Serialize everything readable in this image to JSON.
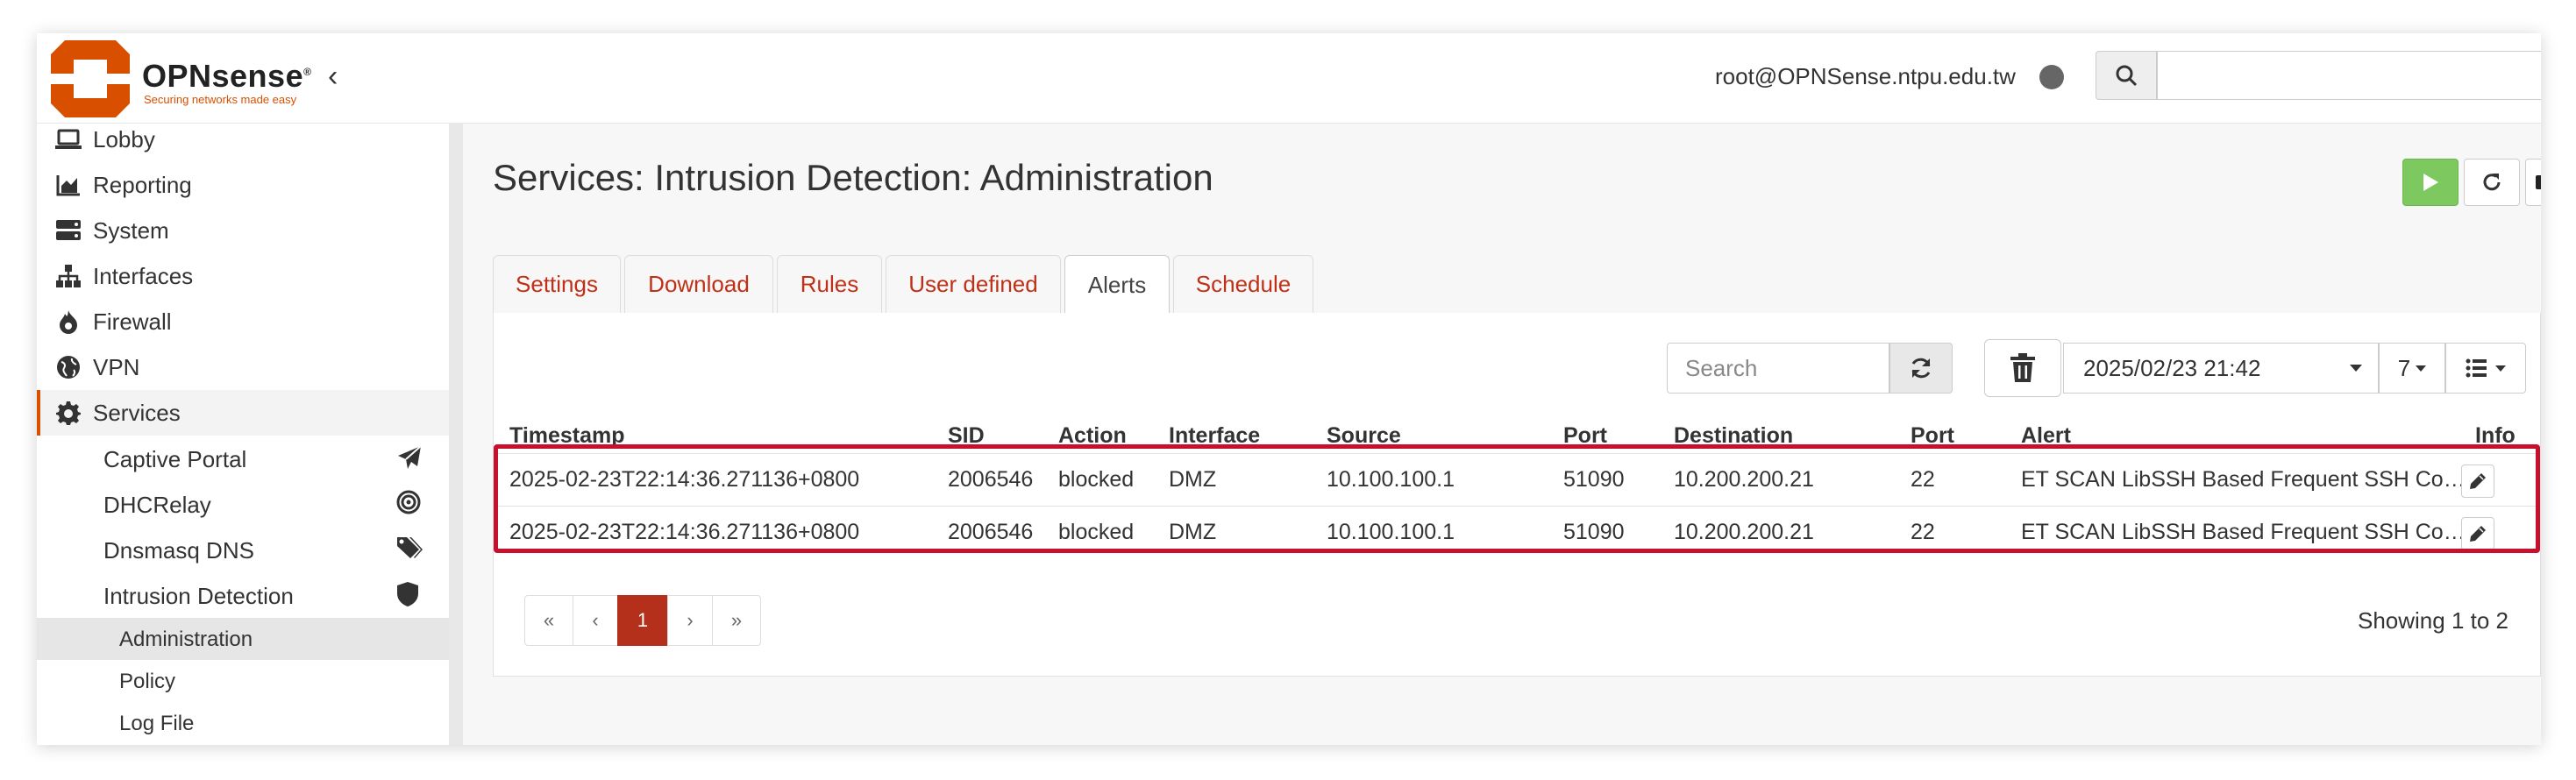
{
  "header": {
    "brand": "OPNsense",
    "brand_mark": "®",
    "tagline": "Securing networks made easy",
    "user": "root@OPNSense.ntpu.edu.tw",
    "colors": {
      "brand": "#d94f00",
      "accent": "#c03017"
    }
  },
  "sidebar": {
    "items": [
      {
        "label": "Lobby",
        "icon": "laptop-icon"
      },
      {
        "label": "Reporting",
        "icon": "area-chart-icon"
      },
      {
        "label": "System",
        "icon": "server-icon"
      },
      {
        "label": "Interfaces",
        "icon": "sitemap-icon"
      },
      {
        "label": "Firewall",
        "icon": "fire-icon"
      },
      {
        "label": "VPN",
        "icon": "globe-icon"
      },
      {
        "label": "Services",
        "icon": "gear-icon"
      }
    ],
    "services": [
      {
        "label": "Captive Portal",
        "icon": "paper-plane-icon"
      },
      {
        "label": "DHCRelay",
        "icon": "bullseye-icon"
      },
      {
        "label": "Dnsmasq DNS",
        "icon": "tags-icon"
      },
      {
        "label": "Intrusion Detection",
        "icon": "shield-icon"
      }
    ],
    "ids": [
      {
        "label": "Administration"
      },
      {
        "label": "Policy"
      },
      {
        "label": "Log File"
      }
    ]
  },
  "page": {
    "title": "Services: Intrusion Detection: Administration"
  },
  "tabs": [
    {
      "label": "Settings"
    },
    {
      "label": "Download"
    },
    {
      "label": "Rules"
    },
    {
      "label": "User defined"
    },
    {
      "label": "Alerts"
    },
    {
      "label": "Schedule"
    }
  ],
  "toolbar": {
    "search_placeholder": "Search",
    "date": "2025/02/23 21:42",
    "rows": "7"
  },
  "table": {
    "columns": [
      "Timestamp",
      "SID",
      "Action",
      "Interface",
      "Source",
      "Port",
      "Destination",
      "Port",
      "Alert",
      "Info"
    ],
    "rows": [
      [
        "2025-02-23T22:14:36.271136+0800",
        "2006546",
        "blocked",
        "DMZ",
        "10.100.100.1",
        "51090",
        "10.200.200.21",
        "22",
        "ET SCAN LibSSH Based Frequent SSH Co…"
      ],
      [
        "2025-02-23T22:14:36.271136+0800",
        "2006546",
        "blocked",
        "DMZ",
        "10.100.100.1",
        "51090",
        "10.200.200.21",
        "22",
        "ET SCAN LibSSH Based Frequent SSH Co…"
      ]
    ]
  },
  "pagination": {
    "first": "«",
    "prev": "‹",
    "current": "1",
    "next": "›",
    "last": "»",
    "showing": "Showing 1 to 2"
  }
}
